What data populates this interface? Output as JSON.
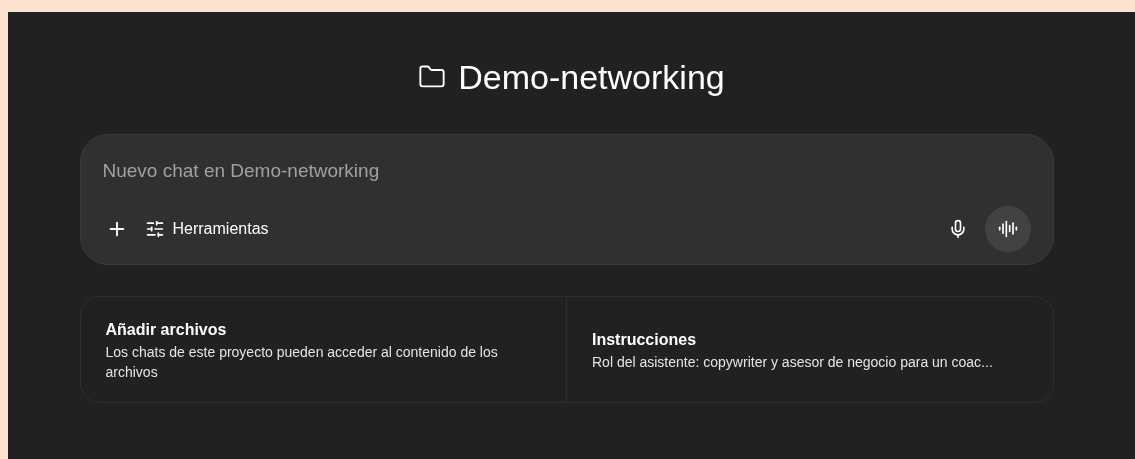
{
  "project": {
    "title": "Demo-networking"
  },
  "composer": {
    "placeholder": "Nuevo chat en Demo-networking",
    "tools_label": "Herramientas"
  },
  "cards": [
    {
      "title": "Añadir archivos",
      "description": "Los chats de este proyecto pueden acceder al contenido de los archivos"
    },
    {
      "title": "Instrucciones",
      "description": "Rol del asistente: copywriter y asesor de negocio para un coac..."
    }
  ]
}
